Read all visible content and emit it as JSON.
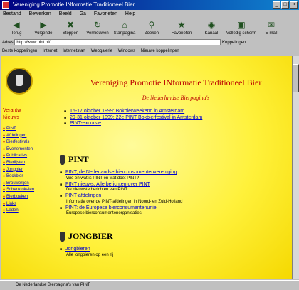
{
  "window": {
    "title": "Vereniging Promotie INformatie Traditioneel Bier"
  },
  "menu": [
    "Bestand",
    "Bewerken",
    "Beeld",
    "Ga",
    "Favorieten",
    "Help"
  ],
  "toolbar": [
    {
      "label": "Terug",
      "icon": "back-icon"
    },
    {
      "label": "Volgende",
      "icon": "forward-icon"
    },
    {
      "label": "Stoppen",
      "icon": "stop-icon"
    },
    {
      "label": "Vernieuwen",
      "icon": "refresh-icon"
    },
    {
      "label": "Startpagina",
      "icon": "home-icon"
    },
    {
      "label": "Zoeken",
      "icon": "search-icon"
    },
    {
      "label": "Favorieten",
      "icon": "favorites-icon"
    },
    {
      "label": "Kanaal",
      "icon": "channel-icon"
    },
    {
      "label": "Volledig scherm",
      "icon": "fullscreen-icon"
    },
    {
      "label": "E-mail",
      "icon": "mail-icon"
    }
  ],
  "address": {
    "label": "Adres",
    "value": "http://www.pint.nl/",
    "go_label": "Koppelingen"
  },
  "links": [
    "Beste koppelingen",
    "Internet",
    "Internetstart",
    "Webgalerie",
    "Windows",
    "Nieuwe koppelingen"
  ],
  "sidebar": {
    "main_links": [
      "Verantw",
      "Nieuws"
    ],
    "links": [
      "PINT",
      "Afdelingen",
      "Bierfestivals",
      "Evenementen",
      "Publicaties",
      "Bierlijsten",
      "Jongbier",
      "Bockbier",
      "Brouwerijen",
      "Schenklokalen",
      "Bierboeken",
      "Links",
      "Leden"
    ]
  },
  "page": {
    "title": "Vereniging Promotie INformatie Traditioneel Bier",
    "subtitle": "De Nederlandse Bierpagina's",
    "events": [
      {
        "text": "16-17 oktober 1999: Bokbierweekend in Amsterdam"
      },
      {
        "text": "29-31 oktober 1999: 22e PINT Bokbierfestival in Amsterdam"
      },
      {
        "text": "PINT-excursie"
      }
    ],
    "pint_heading": "PINT",
    "pint_items": [
      {
        "link": "PINT, de Nederlandse bierconsumentenvereniging",
        "desc": "Wie en wat is PINT en wat doet PINT?"
      },
      {
        "link": "PINT nieuws: Alle berichten over PINT",
        "desc": "De nieuwste berichten van PINT"
      },
      {
        "link": "PINT-afdelingen",
        "desc": "Informatie over de PINT-afdelingen in Noord- en Zuid-Holland"
      },
      {
        "link": "PINT: de Europese bierconsumentenunie",
        "desc": "Europese bierconsumentenorganisaties"
      }
    ],
    "jong_heading": "JONGBIER",
    "jong_items": [
      {
        "link": "Jongbieren",
        "desc": "Alle jongbieren op een rij"
      }
    ]
  },
  "status": {
    "text": "De Nederlandse Bierpagina's van PINT"
  }
}
